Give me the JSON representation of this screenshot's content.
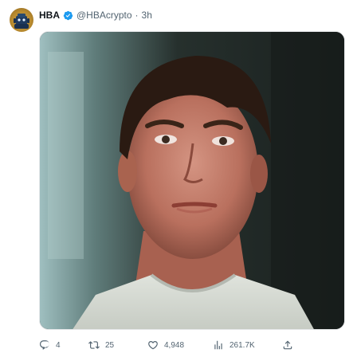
{
  "tweet": {
    "display_name": "HBA",
    "handle": "@HBAcrypto",
    "separator": "·",
    "time": "3h",
    "verified": true,
    "avatar_icon": "robot-avatar-icon",
    "media_description_icon": "photo-media",
    "actions": {
      "replies": "4",
      "retweets": "25",
      "likes": "4,948",
      "views": "261.7K"
    }
  },
  "colors": {
    "verified": "#1d9bf0",
    "secondary_text": "#536471",
    "primary_text": "#0f1419"
  }
}
